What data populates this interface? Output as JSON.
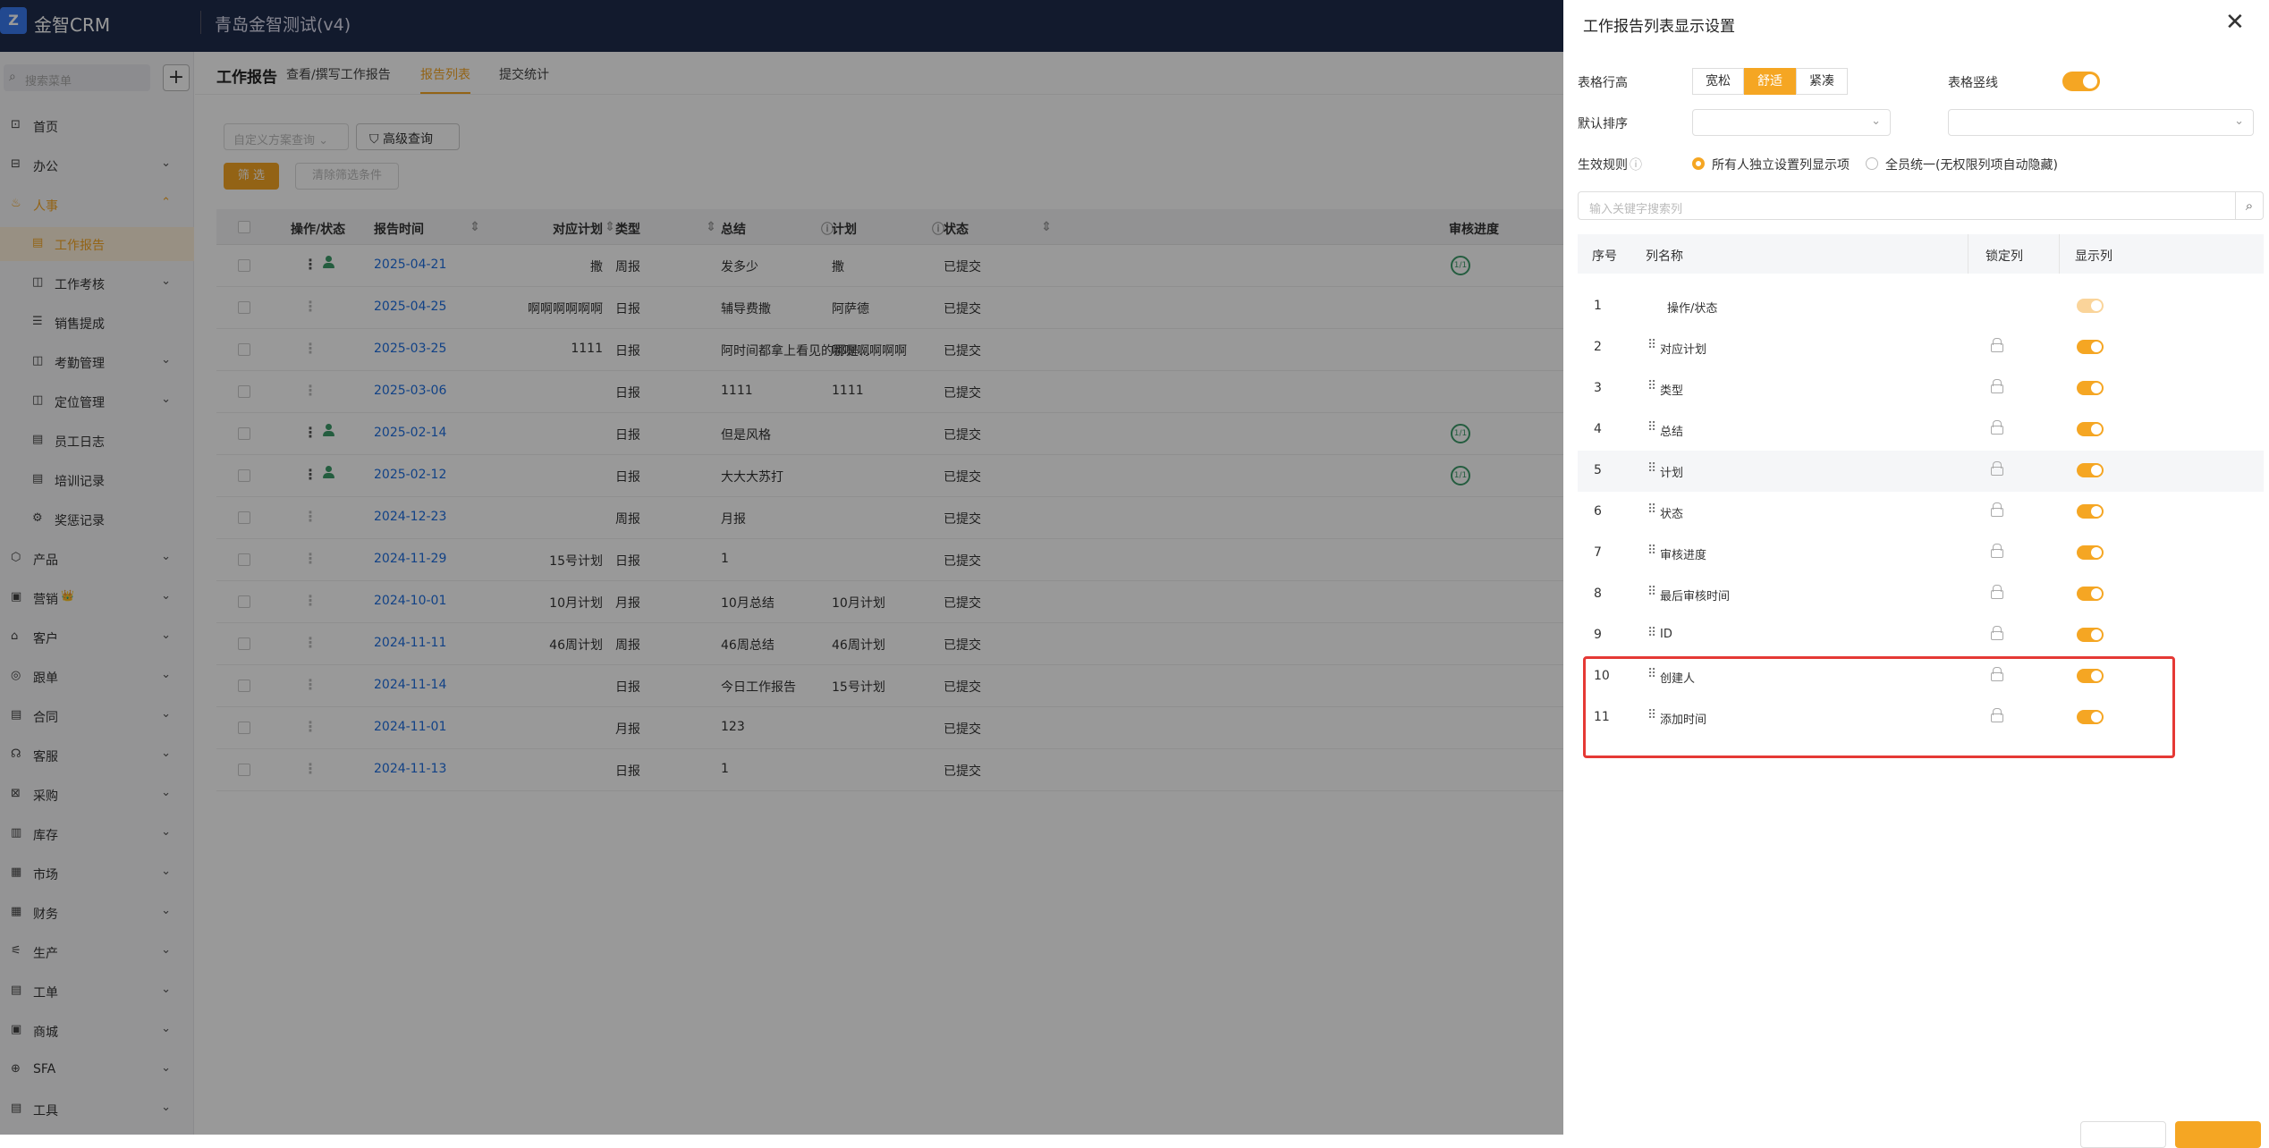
{
  "topbar": {
    "logo": "Z",
    "app_name": "金智CRM",
    "company": "青岛金智测试(v4)"
  },
  "sidebar": {
    "search_placeholder": "搜索菜单",
    "add": "+",
    "items": [
      {
        "label": "首页",
        "icon": "home-icon",
        "chev": ""
      },
      {
        "label": "办公",
        "icon": "office-icon",
        "chev": "⌄"
      },
      {
        "label": "人事",
        "icon": "hr-icon",
        "chev": "⌃"
      },
      {
        "label": "工作报告",
        "icon": "report-icon",
        "chev": ""
      },
      {
        "label": "工作考核",
        "icon": "assess-icon",
        "chev": "⌄"
      },
      {
        "label": "销售提成",
        "icon": "commission-icon",
        "chev": ""
      },
      {
        "label": "考勤管理",
        "icon": "attendance-icon",
        "chev": "⌄"
      },
      {
        "label": "定位管理",
        "icon": "location-icon",
        "chev": "⌄"
      },
      {
        "label": "员工日志",
        "icon": "log-icon",
        "chev": ""
      },
      {
        "label": "培训记录",
        "icon": "training-icon",
        "chev": ""
      },
      {
        "label": "奖惩记录",
        "icon": "award-icon",
        "chev": ""
      },
      {
        "label": "产品",
        "icon": "product-icon",
        "chev": "⌄"
      },
      {
        "label": "营销",
        "icon": "marketing-icon",
        "chev": "⌄",
        "badge": "👑"
      },
      {
        "label": "客户",
        "icon": "customer-icon",
        "chev": "⌄"
      },
      {
        "label": "跟单",
        "icon": "follow-icon",
        "chev": "⌄"
      },
      {
        "label": "合同",
        "icon": "contract-icon",
        "chev": "⌄"
      },
      {
        "label": "客服",
        "icon": "service-icon",
        "chev": "⌄"
      },
      {
        "label": "采购",
        "icon": "purchase-icon",
        "chev": "⌄"
      },
      {
        "label": "库存",
        "icon": "inventory-icon",
        "chev": "⌄"
      },
      {
        "label": "市场",
        "icon": "market-icon",
        "chev": "⌄"
      },
      {
        "label": "财务",
        "icon": "finance-icon",
        "chev": "⌄"
      },
      {
        "label": "生产",
        "icon": "production-icon",
        "chev": "⌄"
      },
      {
        "label": "工单",
        "icon": "workorder-icon",
        "chev": "⌄"
      },
      {
        "label": "商城",
        "icon": "mall-icon",
        "chev": "⌄"
      },
      {
        "label": "SFA",
        "icon": "sfa-icon",
        "chev": "⌄"
      },
      {
        "label": "工具",
        "icon": "tools-icon",
        "chev": "⌄"
      }
    ]
  },
  "page": {
    "title": "工作报告",
    "tabs": [
      "查看/撰写工作报告",
      "报告列表",
      "提交统计"
    ],
    "scheme_placeholder": "自定义方案查询",
    "advanced": "高级查询",
    "filter_btn": "筛 选",
    "clear_btn": "清除筛选条件",
    "columns": [
      "操作/状态",
      "报告时间",
      "对应计划",
      "类型",
      "总结",
      "计划",
      "状态",
      "审核进度"
    ],
    "rows": [
      {
        "date": "2025-04-21",
        "plan_ref": "撒",
        "type": "周报",
        "summary": "发多少",
        "plan": "撒",
        "status": "已提交",
        "review": "1/1"
      },
      {
        "date": "2025-04-25",
        "plan_ref": "啊啊啊啊啊啊",
        "type": "日报",
        "summary": "辅导费撒",
        "plan": "阿萨德",
        "status": "已提交",
        "review": ""
      },
      {
        "date": "2025-03-25",
        "plan_ref": "1111",
        "type": "日报",
        "summary": "阿时间都拿上看见的那是...",
        "plan": "啊啊啊啊啊啊",
        "status": "已提交",
        "review": ""
      },
      {
        "date": "2025-03-06",
        "plan_ref": "",
        "type": "日报",
        "summary": "1111",
        "plan": "1111",
        "status": "已提交",
        "review": ""
      },
      {
        "date": "2025-02-14",
        "plan_ref": "",
        "type": "日报",
        "summary": "但是风格",
        "plan": "",
        "status": "已提交",
        "review": "1/1"
      },
      {
        "date": "2025-02-12",
        "plan_ref": "",
        "type": "日报",
        "summary": "大大大苏打",
        "plan": "",
        "status": "已提交",
        "review": "1/1"
      },
      {
        "date": "2024-12-23",
        "plan_ref": "",
        "type": "周报",
        "summary": "月报",
        "plan": "",
        "status": "已提交",
        "review": ""
      },
      {
        "date": "2024-11-29",
        "plan_ref": "15号计划",
        "type": "日报",
        "summary": "1",
        "plan": "",
        "status": "已提交",
        "review": ""
      },
      {
        "date": "2024-10-01",
        "plan_ref": "10月计划",
        "type": "月报",
        "summary": "10月总结",
        "plan": "10月计划",
        "status": "已提交",
        "review": ""
      },
      {
        "date": "2024-11-11",
        "plan_ref": "46周计划",
        "type": "周报",
        "summary": "46周总结",
        "plan": "46周计划",
        "status": "已提交",
        "review": ""
      },
      {
        "date": "2024-11-14",
        "plan_ref": "",
        "type": "日报",
        "summary": "今日工作报告",
        "plan": "15号计划",
        "status": "已提交",
        "review": ""
      },
      {
        "date": "2024-11-01",
        "plan_ref": "",
        "type": "月报",
        "summary": "123",
        "plan": "",
        "status": "已提交",
        "review": ""
      },
      {
        "date": "2024-11-13",
        "plan_ref": "",
        "type": "日报",
        "summary": "1",
        "plan": "",
        "status": "已提交",
        "review": ""
      }
    ]
  },
  "panel": {
    "title": "工作报告列表显示设置",
    "close": "✕",
    "row_height_label": "表格行高",
    "row_height_options": [
      "宽松",
      "舒适",
      "紧凑"
    ],
    "row_height_selected": "舒适",
    "vertical_lines_label": "表格竖线",
    "vertical_lines_on": true,
    "default_sort_label": "默认排序",
    "rule_label": "生效规则",
    "rule_help": "?",
    "rule_options": [
      "所有人独立设置列显示项",
      "全员统一(无权限列项自动隐藏)"
    ],
    "rule_selected": 0,
    "search_placeholder": "输入关键字搜索列",
    "col_headers": [
      "序号",
      "列名称",
      "锁定列",
      "显示列"
    ],
    "columns": [
      {
        "no": "1",
        "name": "操作/状态",
        "visible": true,
        "fixed": true
      },
      {
        "no": "2",
        "name": "对应计划",
        "visible": true
      },
      {
        "no": "3",
        "name": "类型",
        "visible": true
      },
      {
        "no": "4",
        "name": "总结",
        "visible": true
      },
      {
        "no": "5",
        "name": "计划",
        "visible": true
      },
      {
        "no": "6",
        "name": "状态",
        "visible": true
      },
      {
        "no": "7",
        "name": "审核进度",
        "visible": true
      },
      {
        "no": "8",
        "name": "最后审核时间",
        "visible": true
      },
      {
        "no": "9",
        "name": "ID",
        "visible": true
      },
      {
        "no": "10",
        "name": "创建人",
        "visible": true
      },
      {
        "no": "11",
        "name": "添加时间",
        "visible": true
      }
    ]
  },
  "colors": {
    "accent": "#f5a623",
    "topbar": "#1e2c4c",
    "link": "#1f6fe0",
    "highlight": "#e53935"
  }
}
